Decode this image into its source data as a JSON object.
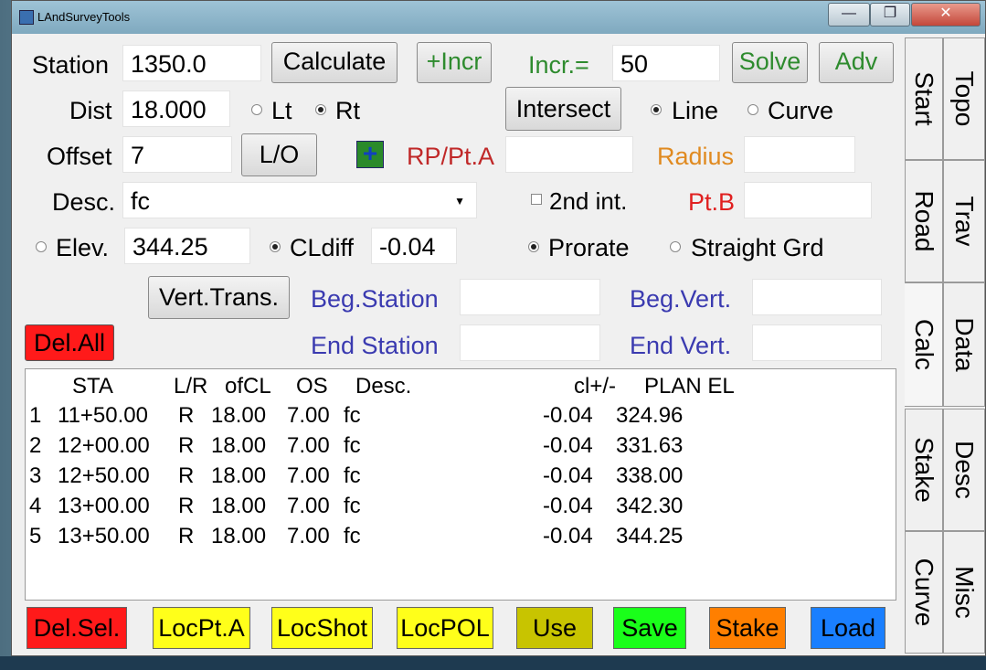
{
  "window": {
    "title": "LAndSurveyTools"
  },
  "form": {
    "station_label": "Station",
    "station_value": "1350.0",
    "calculate_label": "Calculate",
    "incr_button_label": "+Incr",
    "incr_label": "Incr.=",
    "incr_value": "50",
    "solve_label": "Solve",
    "adv_label": "Adv",
    "dist_label": "Dist",
    "dist_value": "18.000",
    "lt_label": "Lt",
    "rt_label": "Rt",
    "intersect_label": "Intersect",
    "line_label": "Line",
    "curve_label": "Curve",
    "offset_label": "Offset",
    "offset_value": "7",
    "lo_label": "L/O",
    "plus_label": "+",
    "rp_label": "RP/Pt.A",
    "rp_value": "",
    "radius_label": "Radius",
    "radius_value": "",
    "desc_label": "Desc.",
    "desc_value": "fc",
    "second_int_label": "2nd int.",
    "ptb_label": "Pt.B",
    "ptb_value": "",
    "elev_label": "Elev.",
    "elev_value": "344.25",
    "cldiff_label": "CLdiff",
    "cldiff_value": "-0.04",
    "prorate_label": "Prorate",
    "straight_label": "Straight Grd",
    "vert_trans_label": "Vert.Trans.",
    "beg_station_label": "Beg.Station",
    "beg_station_value": "",
    "beg_vert_label": "Beg.Vert.",
    "beg_vert_value": "",
    "delall_label": "Del.All",
    "end_station_label": "End Station",
    "end_station_value": "",
    "end_vert_label": "End Vert.",
    "end_vert_value": ""
  },
  "results": {
    "headers": [
      "STA",
      "L/R",
      "ofCL",
      "OS",
      "Desc.",
      "cl+/-",
      "PLAN EL"
    ],
    "rows": [
      [
        "1",
        "11+50.00",
        "R",
        "18.00",
        "7.00",
        "fc",
        "-0.04",
        "324.96"
      ],
      [
        "2",
        "12+00.00",
        "R",
        "18.00",
        "7.00",
        "fc",
        "-0.04",
        "331.63"
      ],
      [
        "3",
        "12+50.00",
        "R",
        "18.00",
        "7.00",
        "fc",
        "-0.04",
        "338.00"
      ],
      [
        "4",
        "13+00.00",
        "R",
        "18.00",
        "7.00",
        "fc",
        "-0.04",
        "342.30"
      ],
      [
        "5",
        "13+50.00",
        "R",
        "18.00",
        "7.00",
        "fc",
        "-0.04",
        "344.25"
      ]
    ]
  },
  "bottom_buttons": [
    {
      "label": "Del.Sel.",
      "color": "#ff1a1a"
    },
    {
      "label": "LocPt.A",
      "color": "#ffff1a"
    },
    {
      "label": "LocShot",
      "color": "#ffff1a"
    },
    {
      "label": "LocPOL",
      "color": "#ffff1a"
    },
    {
      "label": "Use",
      "color": "#c8c400"
    },
    {
      "label": "Save",
      "color": "#1aff1a"
    },
    {
      "label": "Stake",
      "color": "#ff7f00"
    },
    {
      "label": "Load",
      "color": "#1a7fff"
    }
  ],
  "tabs": {
    "start": "Start",
    "topo": "Topo",
    "road": "Road",
    "trav": "Trav",
    "calc": "Calc",
    "data": "Data",
    "stake": "Stake",
    "desc": "Desc",
    "curve": "Curve",
    "misc": "Misc"
  }
}
